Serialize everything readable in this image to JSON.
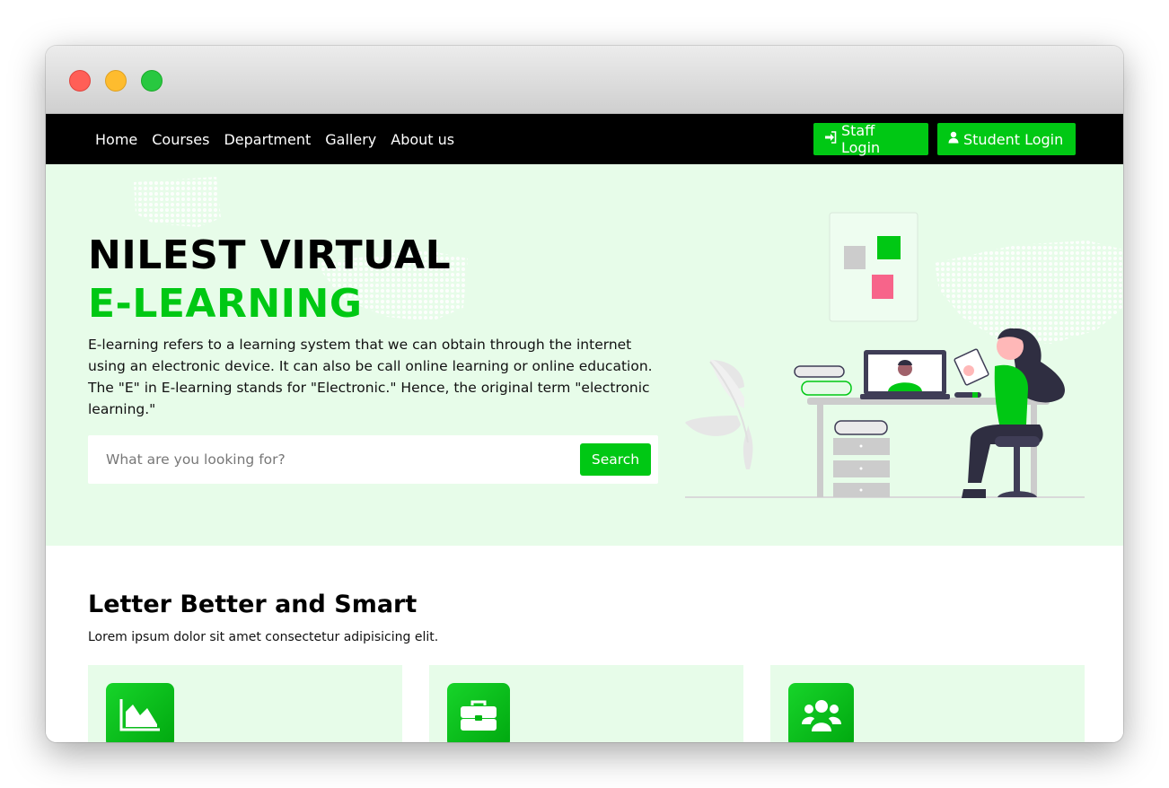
{
  "nav": {
    "links": [
      "Home",
      "Courses",
      "Department",
      "Gallery",
      "About us"
    ],
    "staff_login": "Staff Login",
    "student_login": "Student Login"
  },
  "hero": {
    "title_line1": "NILEST VIRTUAL",
    "title_line2": "E-LEARNING",
    "description": "E-learning refers to a learning system that we can obtain through the internet using an electronic device. It can also be call online learning or online education. The \"E\" in E-learning stands for \"Electronic.\" Hence, the original term \"electronic learning.\"",
    "search_placeholder": "What are you looking for?",
    "search_button": "Search"
  },
  "section": {
    "title": "Letter Better and Smart",
    "subtitle": "Lorem ipsum dolor sit amet consectetur adipisicing elit.",
    "cards": [
      {
        "icon": "area-chart-icon"
      },
      {
        "icon": "briefcase-icon"
      },
      {
        "icon": "users-icon"
      }
    ]
  },
  "colors": {
    "accent": "#00c814",
    "hero_bg": "#e7fce9",
    "navbar_bg": "#000000"
  }
}
